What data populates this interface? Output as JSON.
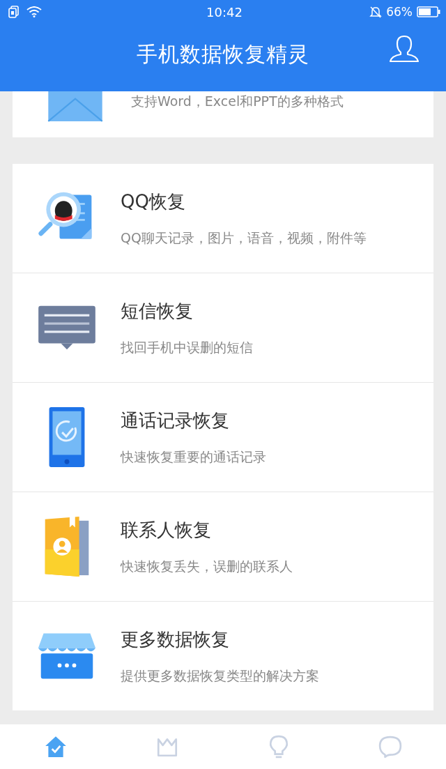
{
  "status_bar": {
    "time": "10:42",
    "battery": "66%"
  },
  "header": {
    "title": "手机数据恢复精灵"
  },
  "partial_card": {
    "subtitle": "支持Word，Excel和PPT的多种格式"
  },
  "items": [
    {
      "title": "QQ恢复",
      "subtitle": "QQ聊天记录，图片，语音，视频，附件等"
    },
    {
      "title": "短信恢复",
      "subtitle": "找回手机中误删的短信"
    },
    {
      "title": "通话记录恢复",
      "subtitle": "快速恢复重要的通话记录"
    },
    {
      "title": "联系人恢复",
      "subtitle": "快速恢复丢失，误删的联系人"
    },
    {
      "title": "更多数据恢复",
      "subtitle": "提供更多数据恢复类型的解决方案"
    }
  ],
  "bottom_nav": [
    {
      "selected": true
    },
    {
      "selected": false
    },
    {
      "selected": false
    },
    {
      "selected": false
    }
  ]
}
